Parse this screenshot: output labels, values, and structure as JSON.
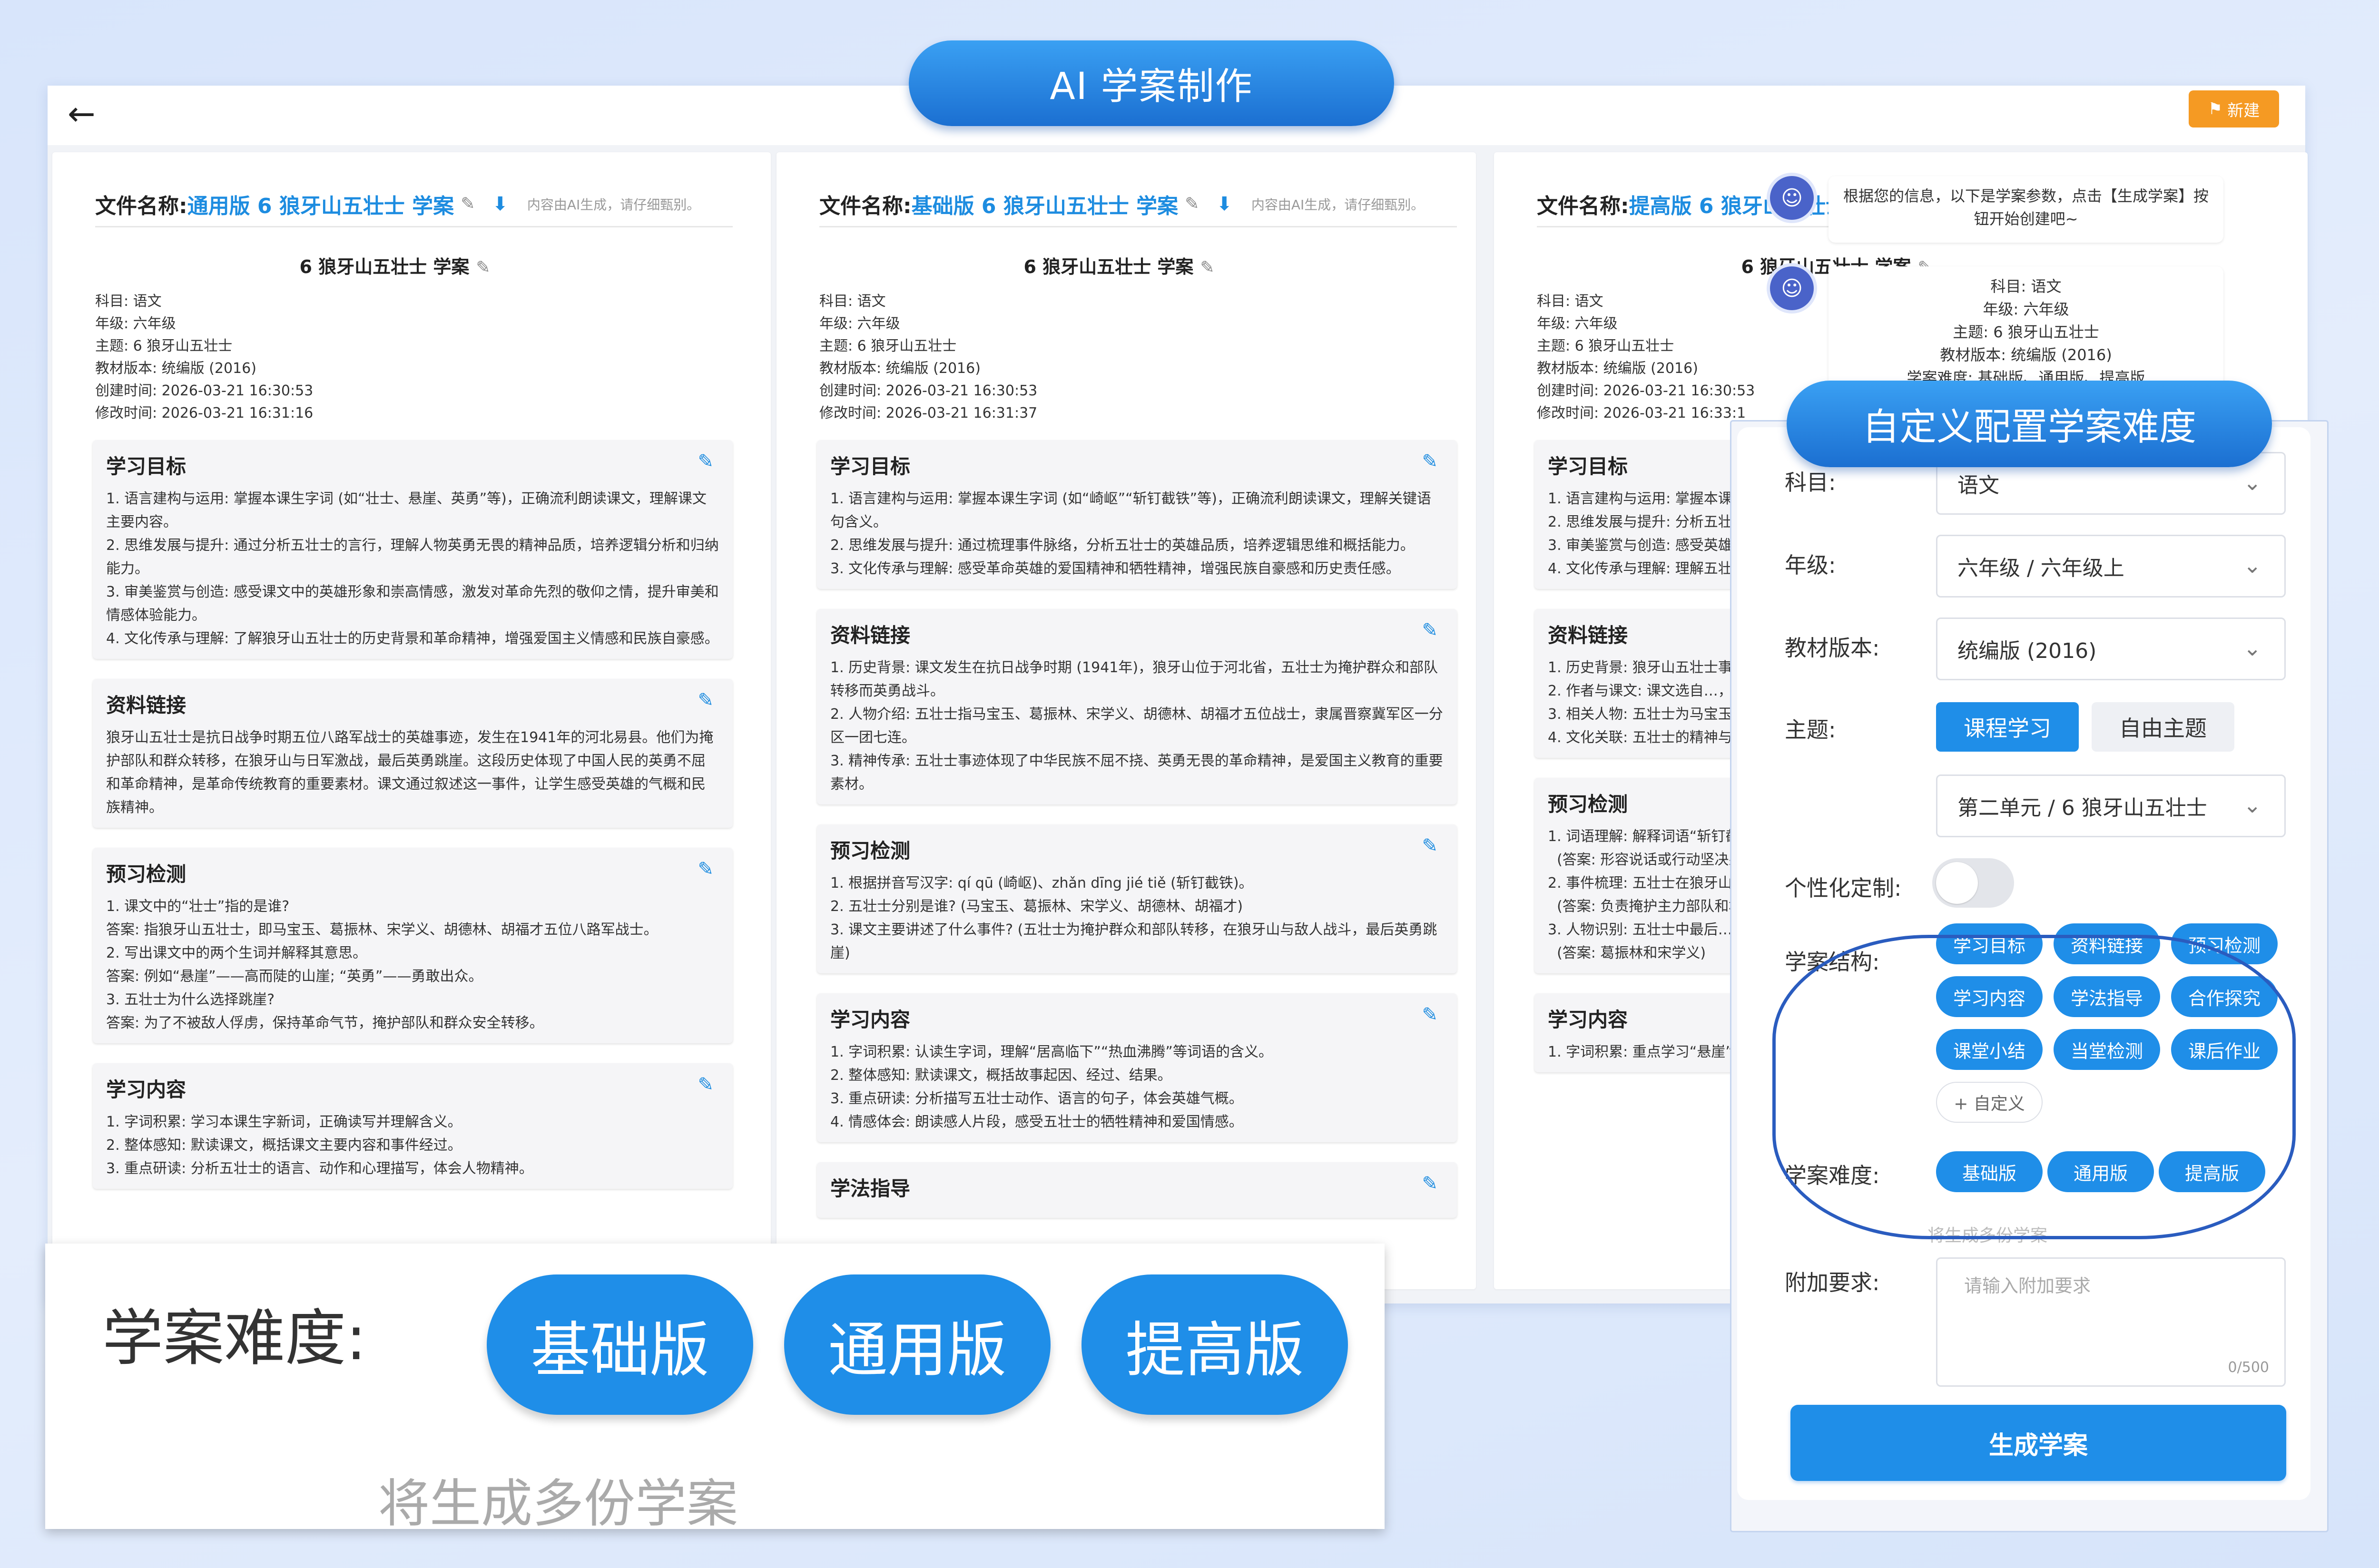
{
  "header_title": "AI 学案制作",
  "new_button": "新建",
  "doc_file_label": "文件名称:",
  "doc_ai_note": "内容由AI生成，请仔细甄别。",
  "doc_title": "6 狼牙山五壮士 学案",
  "documents": [
    {
      "file_name": "通用版 6 狼牙山五壮士 学案",
      "meta": [
        "科目: 语文",
        "年级: 六年级",
        "主题: 6 狼牙山五壮士",
        "教材版本: 统编版 (2016)",
        "创建时间: 2026-03-21 16:30:53",
        "修改时间: 2026-03-21 16:31:16"
      ],
      "sections": [
        {
          "title": "学习目标",
          "body": "1. 语言建构与运用: 掌握本课生字词 (如“壮士、悬崖、英勇”等)，正确流利朗读课文，理解课文主要内容。\n2. 思维发展与提升: 通过分析五壮士的言行，理解人物英勇无畏的精神品质，培养逻辑分析和归纳能力。\n3. 审美鉴赏与创造: 感受课文中的英雄形象和崇高情感，激发对革命先烈的敬仰之情，提升审美和情感体验能力。\n4. 文化传承与理解: 了解狼牙山五壮士的历史背景和革命精神，增强爱国主义情感和民族自豪感。"
        },
        {
          "title": "资料链接",
          "body": "狼牙山五壮士是抗日战争时期五位八路军战士的英雄事迹，发生在1941年的河北易县。他们为掩护部队和群众转移，在狼牙山与日军激战，最后英勇跳崖。这段历史体现了中国人民的英勇不屈和革命精神，是革命传统教育的重要素材。课文通过叙述这一事件，让学生感受英雄的气概和民族精神。"
        },
        {
          "title": "预习检测",
          "body": "1. 课文中的“壮士”指的是谁?\n答案: 指狼牙山五壮士，即马宝玉、葛振林、宋学义、胡德林、胡福才五位八路军战士。\n2. 写出课文中的两个生词并解释其意思。\n答案: 例如“悬崖”——高而陡的山崖; “英勇”——勇敢出众。\n3. 五壮士为什么选择跳崖?\n答案: 为了不被敌人俘虏，保持革命气节，掩护部队和群众安全转移。"
        },
        {
          "title": "学习内容",
          "body": "1. 字词积累: 学习本课生字新词，正确读写并理解含义。\n2. 整体感知: 默读课文，概括课文主要内容和事件经过。\n3. 重点研读: 分析五壮士的语言、动作和心理描写，体会人物精神。"
        }
      ]
    },
    {
      "file_name": "基础版 6 狼牙山五壮士 学案",
      "meta": [
        "科目: 语文",
        "年级: 六年级",
        "主题: 6 狼牙山五壮士",
        "教材版本: 统编版 (2016)",
        "创建时间: 2026-03-21 16:30:53",
        "修改时间: 2026-03-21 16:31:37"
      ],
      "sections": [
        {
          "title": "学习目标",
          "body": "1. 语言建构与运用: 掌握本课生字词 (如“崎岖”“斩钉截铁”等)，正确流利朗读课文，理解关键语句含义。\n2. 思维发展与提升: 通过梳理事件脉络，分析五壮士的英雄品质，培养逻辑思维和概括能力。\n3. 文化传承与理解: 感受革命英雄的爱国精神和牺牲精神，增强民族自豪感和历史责任感。"
        },
        {
          "title": "资料链接",
          "body": "1. 历史背景: 课文发生在抗日战争时期 (1941年)，狼牙山位于河北省，五壮士为掩护群众和部队转移而英勇战斗。\n2. 人物介绍: 五壮士指马宝玉、葛振林、宋学义、胡德林、胡福才五位战士，隶属晋察冀军区一分区一团七连。\n3. 精神传承: 五壮士事迹体现了中华民族不屈不挠、英勇无畏的革命精神，是爱国主义教育的重要素材。"
        },
        {
          "title": "预习检测",
          "body": "1. 根据拼音写汉字: qí qū (崎岖)、zhǎn dīng jié tiě (斩钉截铁)。\n2. 五壮士分别是谁? (马宝玉、葛振林、宋学义、胡德林、胡福才)\n3. 课文主要讲述了什么事件? (五壮士为掩护群众和部队转移，在狼牙山与敌人战斗，最后英勇跳崖)"
        },
        {
          "title": "学习内容",
          "body": "1. 字词积累: 认读生字词，理解“居高临下”“热血沸腾”等词语的含义。\n2. 整体感知: 默读课文，概括故事起因、经过、结果。\n3. 重点研读: 分析描写五壮士动作、语言的句子，体会英雄气概。\n4. 情感体会: 朗读感人片段，感受五壮士的牺牲精神和爱国情感。"
        },
        {
          "title": "学法指导",
          "body": ""
        }
      ]
    },
    {
      "file_name": "提高版 6 狼牙山五壮士 学案",
      "meta": [
        "科目: 语文",
        "年级: 六年级",
        "主题: 6 狼牙山五壮士",
        "教材版本: 统编版 (2016)",
        "创建时间: 2026-03-21 16:30:53",
        "修改时间: 2026-03-21 16:33:1"
      ],
      "sections": [
        {
          "title": "学习目标",
          "body": "1. 语言建构与运用: 掌握本课生字词，在具体语境中的含义和作用。\n2. 思维发展与提升: 分析五壮士的英雄形象，提升逻辑分析和价值判断能力。\n3. 审美鉴赏与创造: 感受英雄形象的崇高美，并能用自己的语言描述和评价。\n4. 文化传承与理解: 理解五壮士精神在中华民族文化中的价值和意义。"
        },
        {
          "title": "资料链接",
          "body": "1. 历史背景: 狼牙山五壮士事迹发生在1941年，击日本侵略者的英勇斗争。\n2. 作者与课文: 课文选自…，感染力的结合。\n3. 相关人物: 五壮士为马宝玉等，隶属晋察冀军区第一军分区某部第七连。\n4. 文化关联: 五壮士的精神与岳飞、文天祥等历史人物的爱国精神一脉相承。"
        },
        {
          "title": "预习检测",
          "body": "1. 词语理解: 解释词语“斩钉截铁”的含义。\n  (答案: 形容说话或行动坚决果断)\n2. 事件梳理: 五壮士在狼牙山…\n  (答案: 负责掩护主力部队和群众转移)\n3. 人物识别: 五壮士中最后…\n  (答案: 葛振林和宋学义)"
        },
        {
          "title": "学习内容",
          "body": "1. 字词积累: 重点学习“悬崖”“…"
        }
      ]
    }
  ],
  "chat": {
    "msg1": "根据您的信息，以下是学案参数，点击【生成学案】按钮开始创建吧~",
    "msg2": [
      "科目: 语文",
      "年级: 六年级",
      "主题: 6 狼牙山五壮士",
      "教材版本: 统编版 (2016)",
      "学案难度: 基础版、通用版、提高版"
    ]
  },
  "config_title": "自定义配置学案难度",
  "config": {
    "subject_label": "科目:",
    "subject_value": "语文",
    "grade_label": "年级:",
    "grade_value": "六年级 / 六年级上",
    "edition_label": "教材版本:",
    "edition_value": "统编版 (2016)",
    "topic_label": "主题:",
    "topic_tab_course": "课程学习",
    "topic_tab_free": "自由主题",
    "topic_value": "第二单元 / 6 狼牙山五壮士",
    "custom_label": "个性化定制:",
    "custom_enabled": false,
    "structure_label": "学案结构:",
    "structure_items": [
      "学习目标",
      "资料链接",
      "预习检测",
      "学习内容",
      "学法指导",
      "合作探究",
      "课堂小结",
      "当堂检测",
      "课后作业"
    ],
    "structure_add": "+ 自定义",
    "difficulty_label": "学案难度:",
    "difficulty_items": [
      "基础版",
      "通用版",
      "提高版"
    ],
    "difficulty_hint": "将生成多份学案",
    "extra_label": "附加要求:",
    "extra_placeholder": "请输入附加要求",
    "extra_counter": "0/500",
    "generate_button": "生成学案"
  },
  "zoom": {
    "label": "学案难度:",
    "items": [
      "基础版",
      "通用版",
      "提高版"
    ],
    "hint": "将生成多份学案"
  },
  "colors": {
    "primary": "#1f8ee8",
    "accent": "#f59a23",
    "link": "#1d8ce0"
  }
}
